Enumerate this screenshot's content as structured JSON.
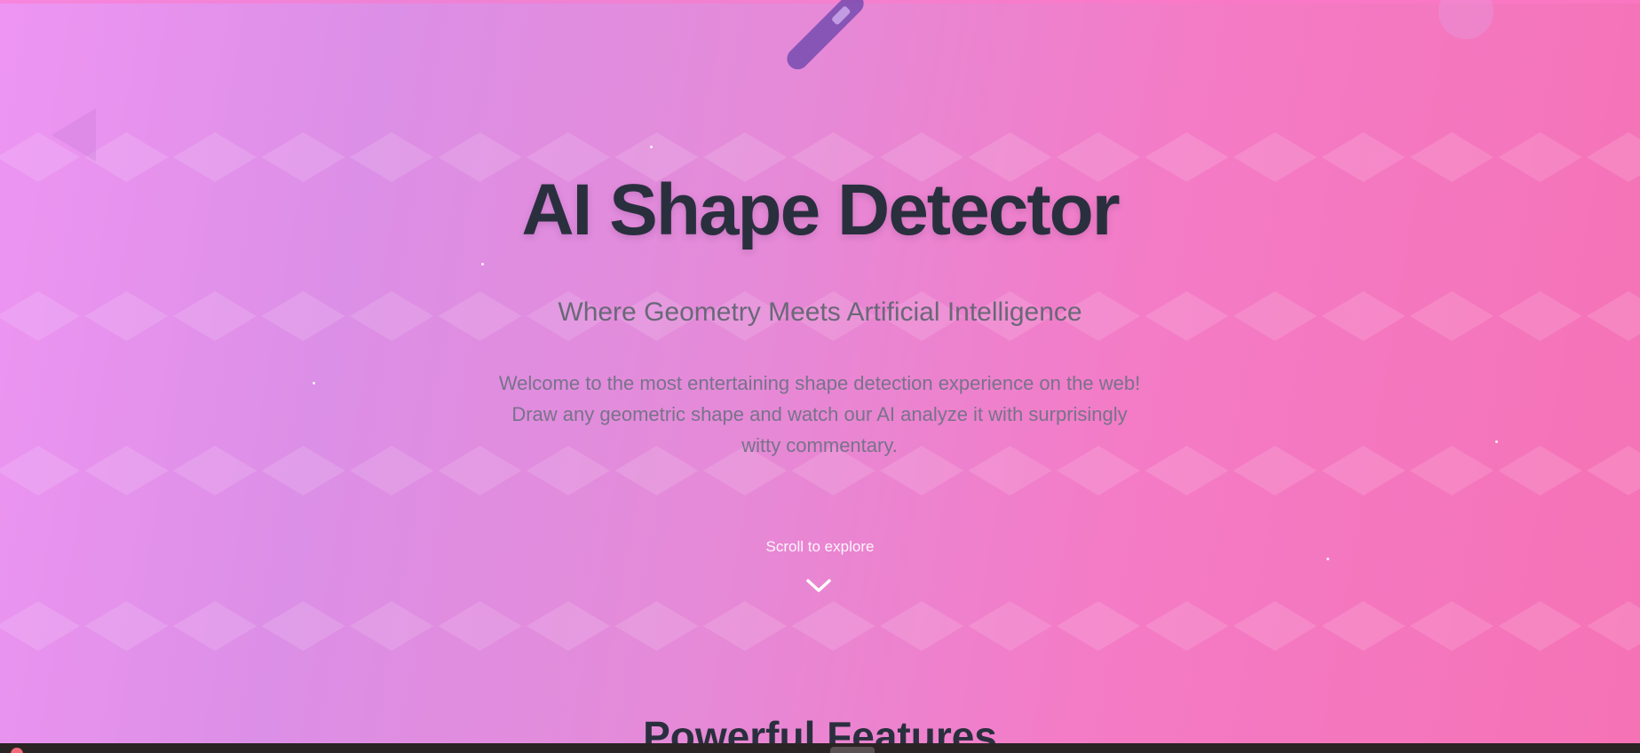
{
  "hero": {
    "title": "AI Shape Detector",
    "subtitle": "Where Geometry Meets Artificial Intelligence",
    "description": "Welcome to the most entertaining shape detection experience on the web! Draw any geometric shape and watch our AI analyze it with surprisingly witty commentary.",
    "scroll_hint": "Scroll to explore"
  },
  "features": {
    "title": "Powerful Features"
  },
  "icons": {
    "hero_icon": "pen-icon",
    "scroll_icon": "chevron-down-icon"
  },
  "colors": {
    "gradient_start": "#ee95f3",
    "gradient_end": "#f572b5",
    "title_text": "#2a2f3e",
    "subtitle_text": "#6a6878",
    "pen_accent": "#7d4fb3"
  }
}
